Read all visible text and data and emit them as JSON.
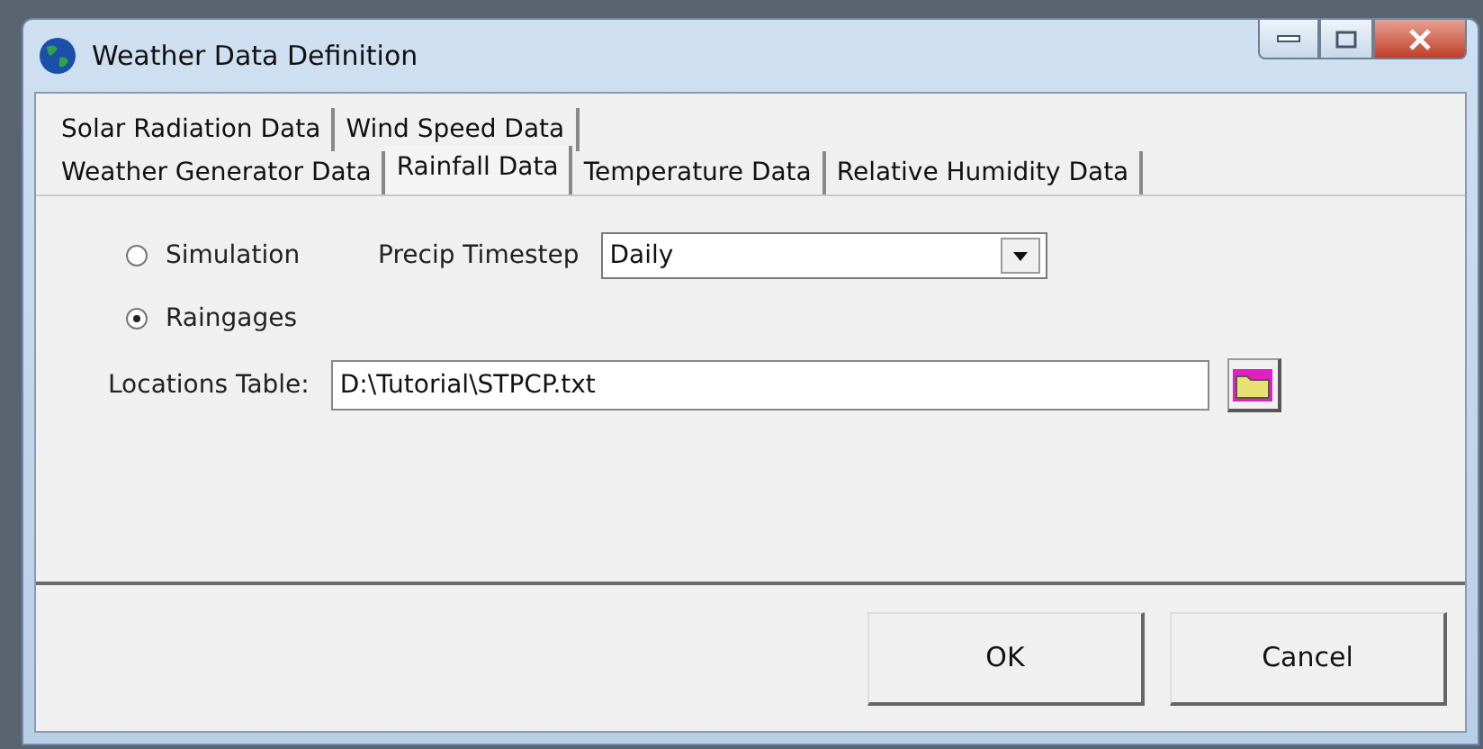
{
  "window": {
    "title": "Weather Data Definition"
  },
  "tab_rows": [
    [
      {
        "label": "Solar Radiation Data",
        "selected": false
      },
      {
        "label": "Wind Speed Data",
        "selected": false
      }
    ],
    [
      {
        "label": "Weather Generator Data",
        "selected": false
      },
      {
        "label": "Rainfall Data",
        "selected": true
      },
      {
        "label": "Temperature Data",
        "selected": false
      },
      {
        "label": "Relative Humidity Data",
        "selected": false
      }
    ]
  ],
  "radios": [
    {
      "label": "Simulation",
      "selected": false
    },
    {
      "label": "Raingages",
      "selected": true
    }
  ],
  "precip_timestep": {
    "label": "Precip Timestep",
    "value": "Daily"
  },
  "locations_table": {
    "label": "Locations Table:",
    "value": "D:\\Tutorial\\STPCP.txt"
  },
  "buttons": [
    "OK",
    "Cancel"
  ]
}
